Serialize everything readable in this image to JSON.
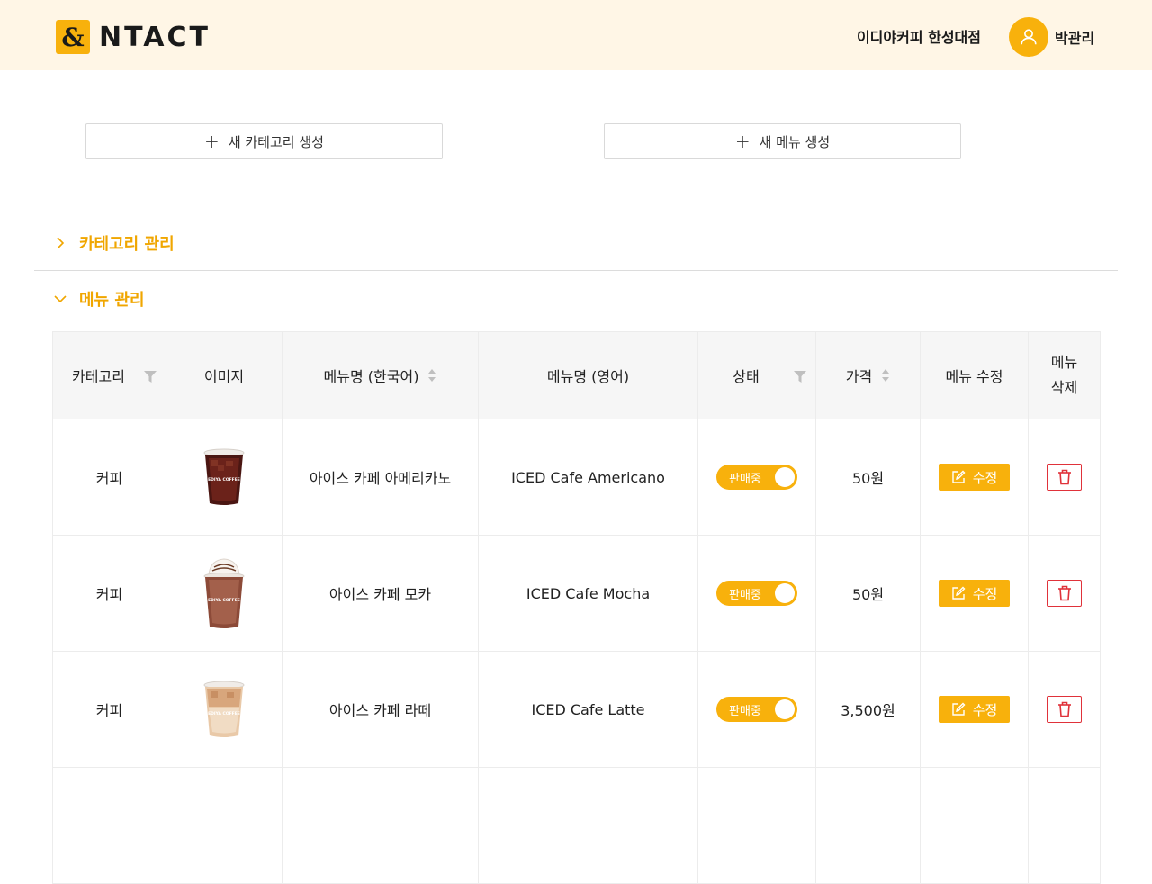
{
  "header": {
    "logo_mark": "&",
    "logo_text": "NTACT",
    "store_name": "이디야커피 한성대점",
    "user_name": "박관리"
  },
  "actions": {
    "new_category": "새 카테고리 생성",
    "new_menu": "새 메뉴 생성"
  },
  "sections": {
    "category": "카테고리 관리",
    "menu": "메뉴 관리"
  },
  "table": {
    "headers": {
      "category": "카테고리",
      "image": "이미지",
      "name_ko": "메뉴명 (한국어)",
      "name_en": "메뉴명 (영어)",
      "status": "상태",
      "price": "가격",
      "edit": "메뉴 수정",
      "delete_line1": "메뉴",
      "delete_line2": "삭제"
    },
    "rows": [
      {
        "category": "커피",
        "name_ko": "아이스 카페 아메리카노",
        "name_en": "ICED Cafe Americano",
        "status": "판매중",
        "price": "50원",
        "edit": "수정",
        "cup_label": "EDIYA COFFEE"
      },
      {
        "category": "커피",
        "name_ko": "아이스 카페 모카",
        "name_en": "ICED Cafe Mocha",
        "status": "판매중",
        "price": "50원",
        "edit": "수정",
        "cup_label": "EDIYA COFFEE"
      },
      {
        "category": "커피",
        "name_ko": "아이스 카페 라떼",
        "name_en": "ICED Cafe Latte",
        "status": "판매중",
        "price": "3,500원",
        "edit": "수정",
        "cup_label": "EDIYA COFFEE"
      }
    ]
  },
  "colors": {
    "accent": "#f8b10c",
    "header_bg": "#fff6e6",
    "danger": "#e0323a"
  }
}
